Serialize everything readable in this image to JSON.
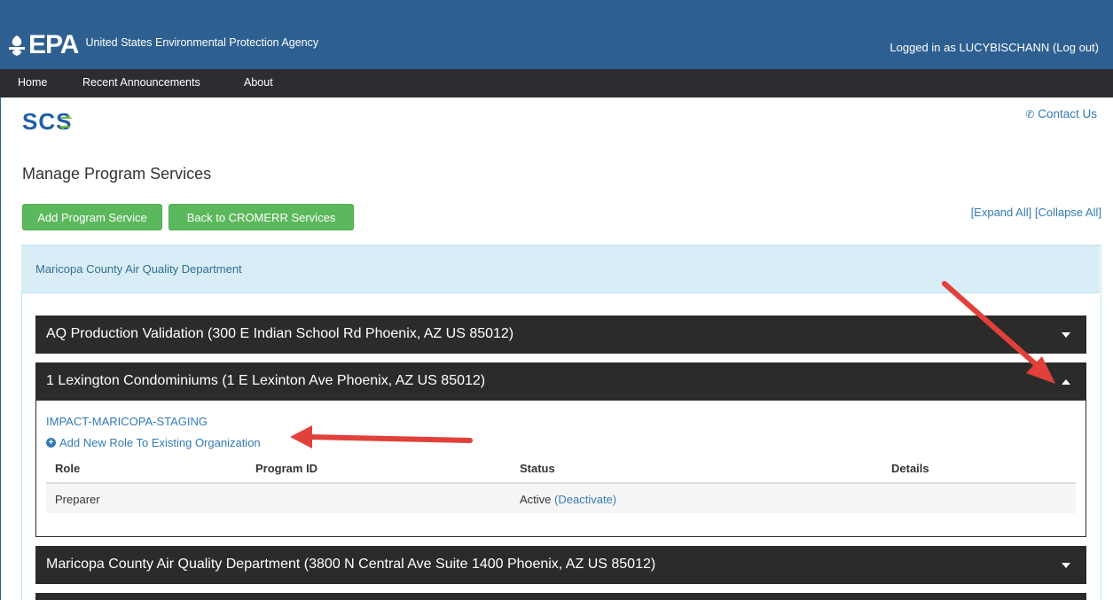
{
  "header": {
    "logo_text": "EPA",
    "agency_name": "United States Environmental Protection Agency",
    "login_prefix": "Logged in as LUCYBISCHANN",
    "logout_label": "(Log out)"
  },
  "nav": {
    "items": [
      {
        "label": "Home"
      },
      {
        "label": "Recent Announcements"
      },
      {
        "label": "About"
      }
    ]
  },
  "app": {
    "logo_text": "SCS",
    "contact_label": "Contact Us"
  },
  "page": {
    "title": "Manage Program Services",
    "add_button": "Add Program Service",
    "back_button": "Back to CROMERR Services",
    "expand_all": "[Expand All]",
    "collapse_all": "[Collapse All]"
  },
  "org_panel": {
    "title": "Maricopa County Air Quality Department"
  },
  "facilities": [
    {
      "label": "AQ Production Validation (300 E Indian School Rd Phoenix, AZ US 85012)",
      "expanded": false
    },
    {
      "label": "1 Lexington Condominiums (1 E Lexinton Ave Phoenix, AZ US 85012)",
      "expanded": true
    },
    {
      "label": "Maricopa County Air Quality Department (3800 N Central Ave Suite 1400 Phoenix, AZ US 85012)",
      "expanded": false
    }
  ],
  "expanded_facility": {
    "organization": "IMPACT-MARICOPA-STAGING",
    "add_role_link": "Add New Role To Existing Organization",
    "columns": [
      "Role",
      "Program ID",
      "Status",
      "Details"
    ],
    "rows": [
      {
        "role": "Preparer",
        "program_id": "",
        "status": "Active",
        "action": "(Deactivate)",
        "details": ""
      }
    ]
  },
  "colors": {
    "header_bg": "#2e5f91",
    "nav_bg": "#2b2d33",
    "button_green": "#5cb85c",
    "link_blue": "#337ab7",
    "panel_head_bg": "#d9edf7",
    "facility_bar_bg": "#2b2b2b",
    "annotation_arrow": "#e2403a"
  }
}
